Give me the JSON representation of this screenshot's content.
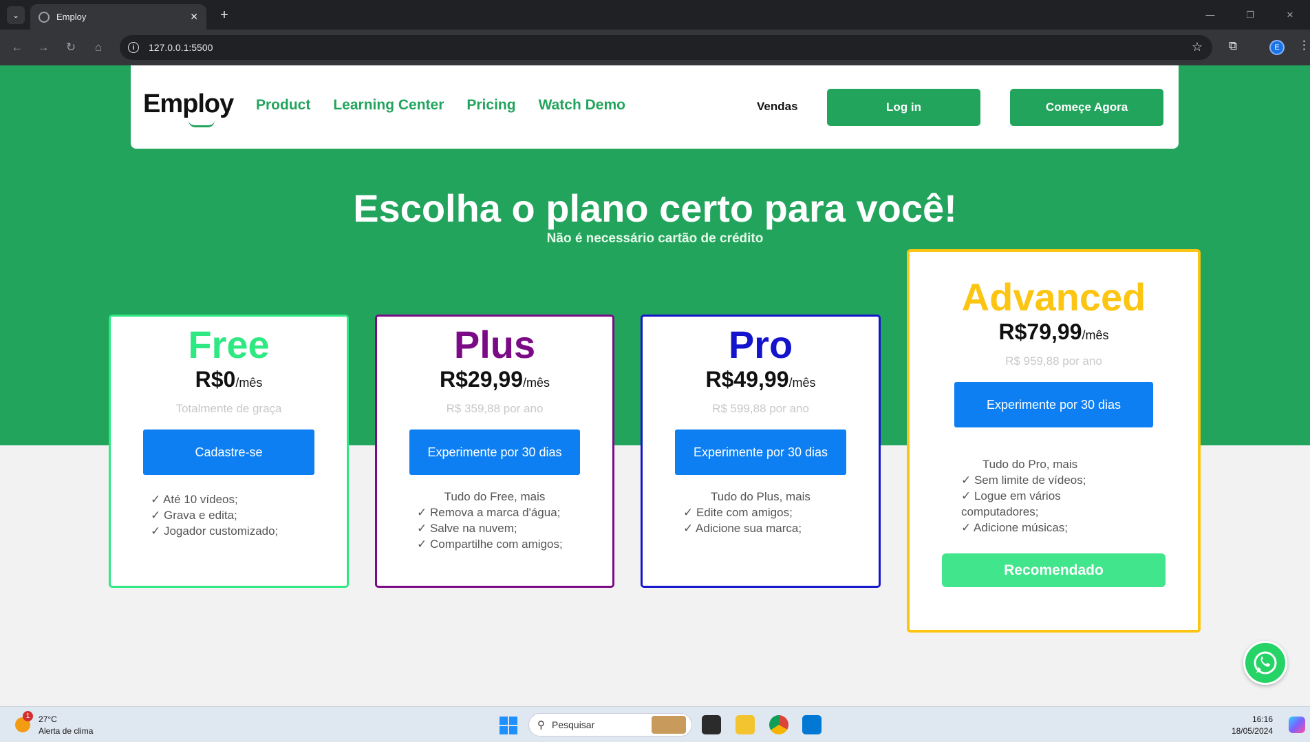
{
  "browser": {
    "tab_title": "Employ",
    "url": "127.0.0.1:5500",
    "profile_initial": "E"
  },
  "site": {
    "logo": "Employ",
    "nav": [
      "Product",
      "Learning Center",
      "Pricing",
      "Watch Demo"
    ],
    "vendas": "Vendas",
    "login": "Log in",
    "start": "Começe Agora",
    "hero_title": "Escolha o plano certo para você!",
    "hero_subtitle": "Não é necessário cartão de crédito"
  },
  "plans": [
    {
      "name": "Free",
      "color": "#2ee882",
      "price": "R$0",
      "per": "/mês",
      "yearly": "Totalmente de graça",
      "cta": "Cadastre-se",
      "intro": "",
      "features": [
        "✓ Até 10 vídeos;",
        "✓ Grava e edita;",
        "✓ Jogador customizado;"
      ]
    },
    {
      "name": "Plus",
      "color": "#7a0a85",
      "price": "R$29,99",
      "per": "/mês",
      "yearly": "R$ 359,88 por ano",
      "cta": "Experimente por 30 dias",
      "intro": "Tudo do Free, mais",
      "features": [
        "✓ Remova a marca d'água;",
        "✓ Salve na nuvem;",
        "✓ Compartilhe com amigos;"
      ]
    },
    {
      "name": "Pro",
      "color": "#1414cc",
      "price": "R$49,99",
      "per": "/mês",
      "yearly": "R$ 599,88 por ano",
      "cta": "Experimente por 30 dias",
      "intro": "Tudo do Plus, mais",
      "features": [
        "✓ Edite com amigos;",
        "✓ Adicione sua marca;"
      ]
    },
    {
      "name": "Advanced",
      "color": "#fcc512",
      "price": "R$79,99",
      "per": "/mês",
      "yearly": "R$ 959,88 por ano",
      "cta": "Experimente por 30 dias",
      "intro": "Tudo do Pro, mais",
      "features": [
        "✓ Sem limite de vídeos;",
        "✓ Logue em vários computadores;",
        "✓ Adicione músicas;"
      ],
      "badge": "Recomendado"
    }
  ],
  "taskbar": {
    "temperature": "27°C",
    "weather_alert": "Alerta de clima",
    "weather_badge": "1",
    "search_placeholder": "Pesquisar",
    "time": "16:16",
    "date": "18/05/2024"
  },
  "colors": {
    "brand_green": "#22a45d",
    "cta_blue": "#0d7ff2",
    "recommended_green": "#41e58b"
  }
}
